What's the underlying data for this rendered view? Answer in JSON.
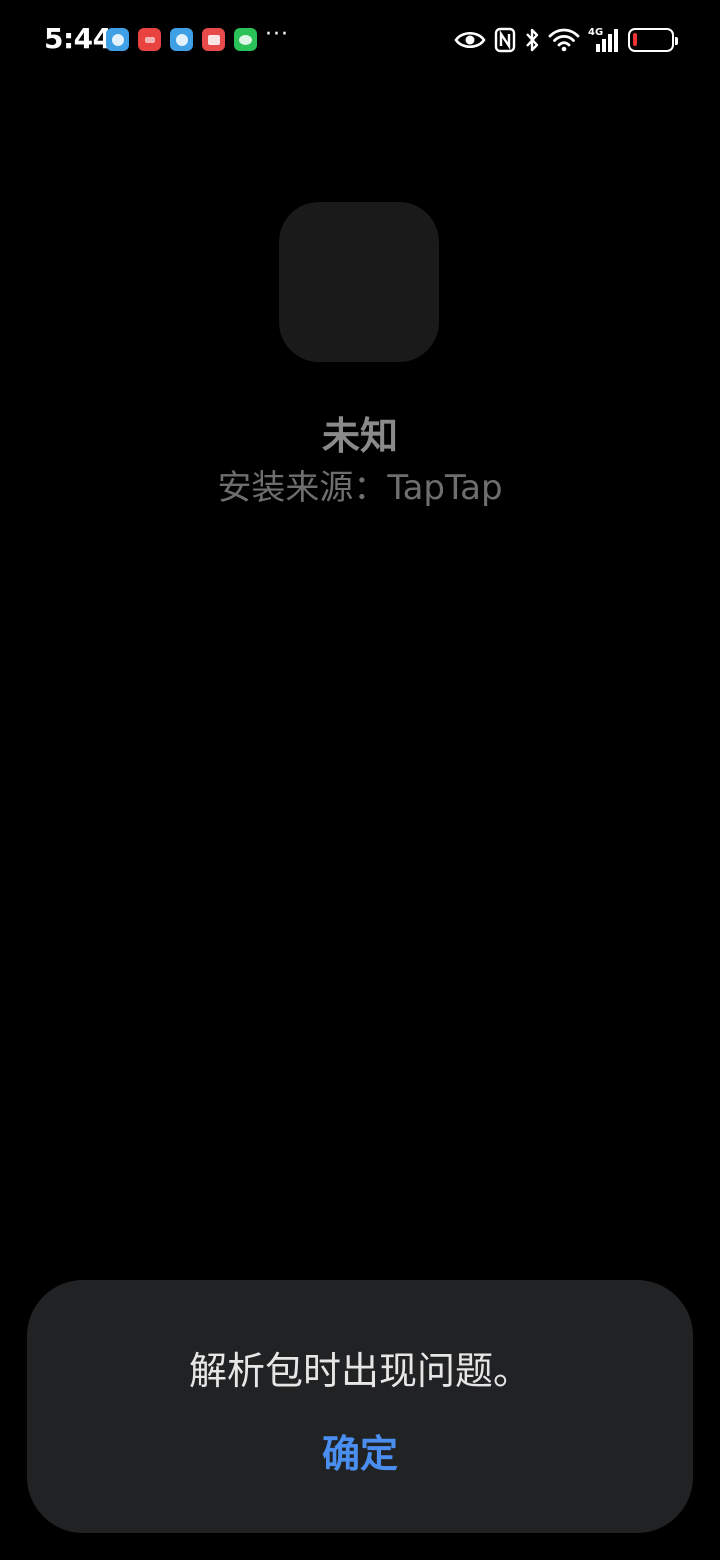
{
  "status_bar": {
    "time": "5:44",
    "notification_icons": [
      {
        "name": "browser-app-icon",
        "color": "#3fa0e6"
      },
      {
        "name": "huawei-appgallery-icon",
        "color": "#e8433f"
      },
      {
        "name": "browser-app-icon-2",
        "color": "#3fa0e6"
      },
      {
        "name": "book-app-icon",
        "color": "#e84a4a"
      },
      {
        "name": "wechat-icon",
        "color": "#2bc25a"
      }
    ],
    "more_indicator": "···",
    "network_type": "4G",
    "battery_color": "#e33333"
  },
  "app": {
    "name": "未知",
    "install_source": "安装来源：TapTap"
  },
  "dialog": {
    "message": "解析包时出现问题。",
    "confirm_label": "确定",
    "accent_color": "#4a8ef0"
  }
}
